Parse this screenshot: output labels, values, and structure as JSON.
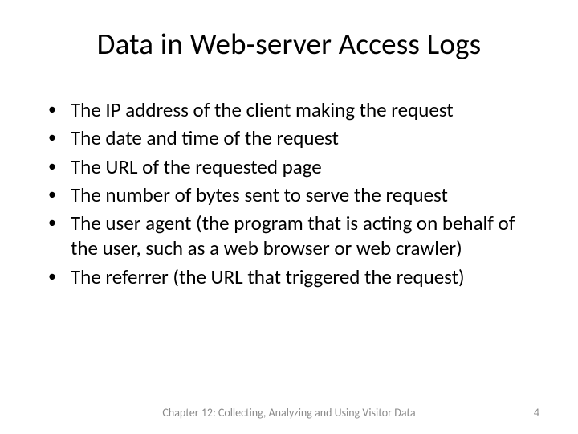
{
  "slide": {
    "title": "Data in Web-server Access Logs",
    "bullets": [
      "The IP address of the client making the request",
      "The date and time of the request",
      "The URL of the requested page",
      "The number of bytes sent to serve the request",
      "The user agent (the program that is acting on behalf of the user, such as a web browser or web crawler)",
      "The referrer (the URL that triggered the request)"
    ],
    "footer": "Chapter 12: Collecting, Analyzing and Using Visitor Data",
    "page_number": "4"
  }
}
